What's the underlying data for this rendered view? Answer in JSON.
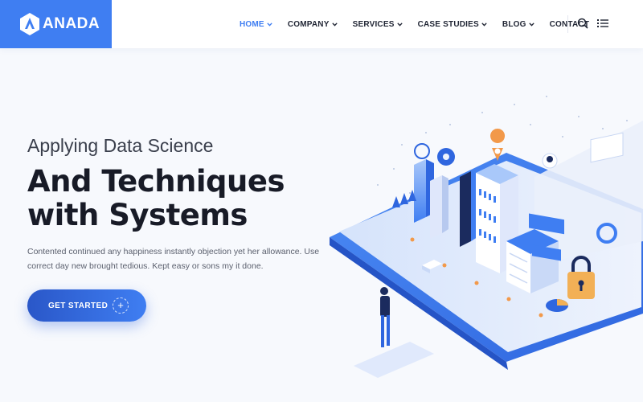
{
  "brand": {
    "name": "ANADA"
  },
  "nav": {
    "items": [
      {
        "label": "HOME",
        "has_dropdown": true,
        "active": true
      },
      {
        "label": "COMPANY",
        "has_dropdown": true,
        "active": false
      },
      {
        "label": "SERVICES",
        "has_dropdown": true,
        "active": false
      },
      {
        "label": "CASE STUDIES",
        "has_dropdown": true,
        "active": false
      },
      {
        "label": "BLOG",
        "has_dropdown": true,
        "active": false
      },
      {
        "label": "CONTACT",
        "has_dropdown": false,
        "active": false
      }
    ],
    "icons": [
      "search-icon",
      "menu-icon"
    ]
  },
  "hero": {
    "subtitle": "Applying Data Science",
    "title_line1": "And Techniques",
    "title_line2": "with Systems",
    "description": "Contented continued any happiness instantly objection yet her allowance. Use correct day new brought tedious. Kept easy or sons my it done.",
    "cta_label": "GET STARTED",
    "cta_icon": "plus-icon"
  },
  "colors": {
    "accent": "#3f7ef2",
    "accent_dark": "#2a57c8",
    "heading": "#181b27",
    "background": "#f7f9fd"
  }
}
